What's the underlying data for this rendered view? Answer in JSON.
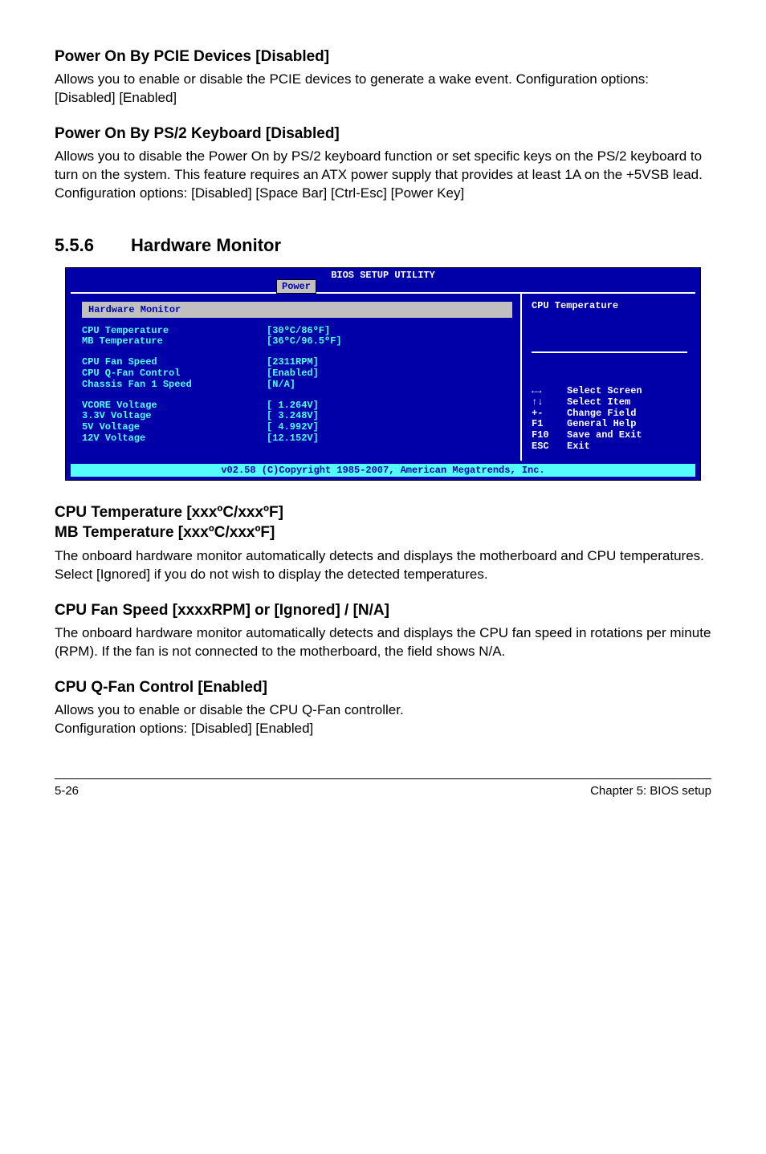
{
  "sections": {
    "pcie": {
      "title": "Power On By PCIE Devices [Disabled]",
      "text": "Allows you to enable or disable the PCIE devices to generate a wake event. Configuration options: [Disabled] [Enabled]"
    },
    "ps2": {
      "title": "Power On By PS/2 Keyboard [Disabled]",
      "text": "Allows you to disable the Power On by PS/2 keyboard function or set specific keys on the PS/2 keyboard to turn on the system. This feature requires an ATX power supply that provides at least 1A on the +5VSB lead.\nConfiguration options: [Disabled] [Space Bar] [Ctrl-Esc] [Power Key]"
    },
    "main": {
      "number": "5.5.6",
      "title": "Hardware Monitor"
    },
    "cputemp": {
      "title": "CPU Temperature [xxxºC/xxxºF]\nMB Temperature [xxxºC/xxxºF]",
      "text": "The onboard hardware monitor automatically detects and displays the motherboard and CPU temperatures. Select [Ignored] if you do not wish to display the detected temperatures."
    },
    "fanspeed": {
      "title": "CPU Fan Speed [xxxxRPM] or [Ignored] / [N/A]",
      "text": "The onboard hardware monitor automatically detects and displays the CPU fan speed in rotations per minute (RPM). If the fan is not connected to the motherboard, the field shows N/A."
    },
    "qfan": {
      "title": "CPU Q-Fan Control [Enabled]",
      "text": "Allows you to enable or disable the CPU Q-Fan controller.\nConfiguration options: [Disabled] [Enabled]"
    }
  },
  "bios": {
    "title": "BIOS SETUP UTILITY",
    "tab": "Power",
    "panel_title": "Hardware Monitor",
    "rows_group1": [
      {
        "label": "CPU Temperature",
        "value": "[30ºC/86ºF]"
      },
      {
        "label": "MB Temperature",
        "value": "[36ºC/96.5ºF]"
      }
    ],
    "rows_group2": [
      {
        "label": "CPU Fan Speed",
        "value": "[2311RPM]"
      },
      {
        "label": "CPU Q-Fan Control",
        "value": "[Enabled]"
      },
      {
        "label": "Chassis Fan 1 Speed",
        "value": "[N/A]"
      }
    ],
    "rows_group3": [
      {
        "label": "VCORE Voltage",
        "value": "[ 1.264V]"
      },
      {
        "label": "3.3V Voltage",
        "value": "[ 3.248V]"
      },
      {
        "label": "5V Voltage",
        "value": "[ 4.992V]"
      },
      {
        "label": "12V Voltage",
        "value": "[12.152V]"
      }
    ],
    "right_title": "CPU Temperature",
    "keys": [
      {
        "key": "←→",
        "action": "Select Screen"
      },
      {
        "key": "↑↓",
        "action": "Select Item"
      },
      {
        "key": "+-",
        "action": "Change Field"
      },
      {
        "key": "F1",
        "action": "General Help"
      },
      {
        "key": "F10",
        "action": "Save and Exit"
      },
      {
        "key": "ESC",
        "action": "Exit"
      }
    ],
    "footer": "v02.58 (C)Copyright 1985-2007, American Megatrends, Inc."
  },
  "footer": {
    "left": "5-26",
    "right": "Chapter 5: BIOS setup"
  }
}
